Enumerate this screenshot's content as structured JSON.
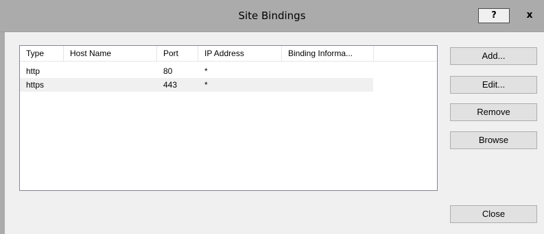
{
  "dialog": {
    "title": "Site Bindings",
    "help_label": "?",
    "close_label": "x"
  },
  "table": {
    "columns": [
      "Type",
      "Host Name",
      "Port",
      "IP Address",
      "Binding Informa..."
    ],
    "rows": [
      [
        "http",
        "",
        "80",
        "*",
        ""
      ],
      [
        "https",
        "",
        "443",
        "*",
        ""
      ]
    ]
  },
  "buttons": {
    "add": "Add...",
    "edit": "Edit...",
    "remove": "Remove",
    "browse": "Browse",
    "close": "Close"
  }
}
